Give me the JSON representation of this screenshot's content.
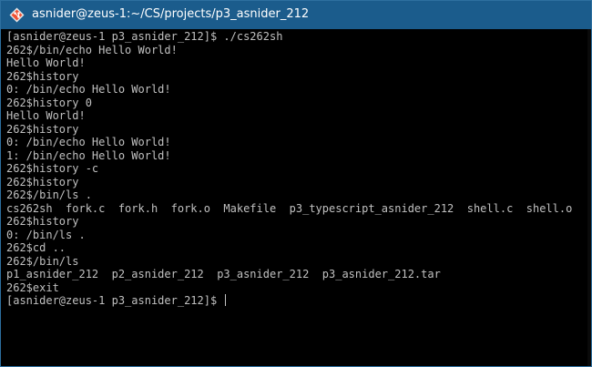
{
  "window": {
    "title": "asnider@zeus-1:~/CS/projects/p3_asnider_212",
    "icon": "git-bash-diamond-icon",
    "title_bar_color": "#1b5c8c"
  },
  "terminal": {
    "background": "#000000",
    "foreground": "#c0c0c0",
    "lines": [
      "[asnider@zeus-1 p3_asnider_212]$ ./cs262sh",
      "262$/bin/echo Hello World!",
      "Hello World!",
      "262$history",
      "0: /bin/echo Hello World!",
      "262$history 0",
      "Hello World!",
      "262$history",
      "0: /bin/echo Hello World!",
      "1: /bin/echo Hello World!",
      "262$history -c",
      "262$history",
      "262$/bin/ls .",
      "cs262sh  fork.c  fork.h  fork.o  Makefile  p3_typescript_asnider_212  shell.c  shell.o",
      "262$history",
      "0: /bin/ls .",
      "262$cd ..",
      "262$/bin/ls",
      "p1_asnider_212  p2_asnider_212  p3_asnider_212  p3_asnider_212.tar",
      "262$exit",
      "[asnider@zeus-1 p3_asnider_212]$ "
    ]
  }
}
